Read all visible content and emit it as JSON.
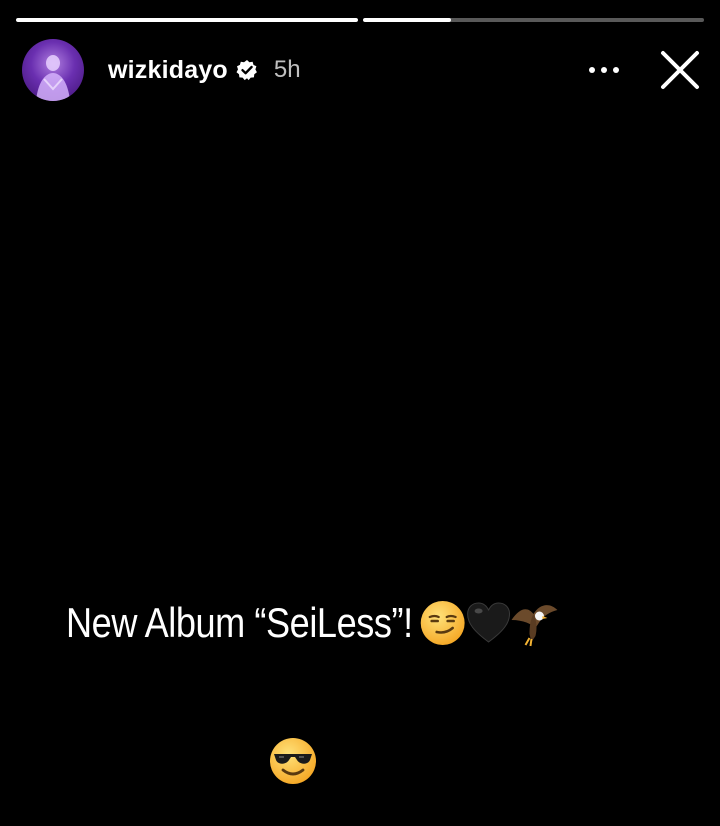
{
  "story": {
    "progress": [
      1.0,
      0.26
    ],
    "username": "wizkidayo",
    "time_ago": "5h",
    "caption": "New Album “SeiLess”!",
    "caption_emojis": [
      "smirk-emoji",
      "black-heart-emoji",
      "eagle-emoji"
    ],
    "sticker_emoji": "sunglasses-emoji"
  },
  "colors": {
    "background": "#000000",
    "text": "#ffffff",
    "avatar": "#6a2fb0"
  }
}
